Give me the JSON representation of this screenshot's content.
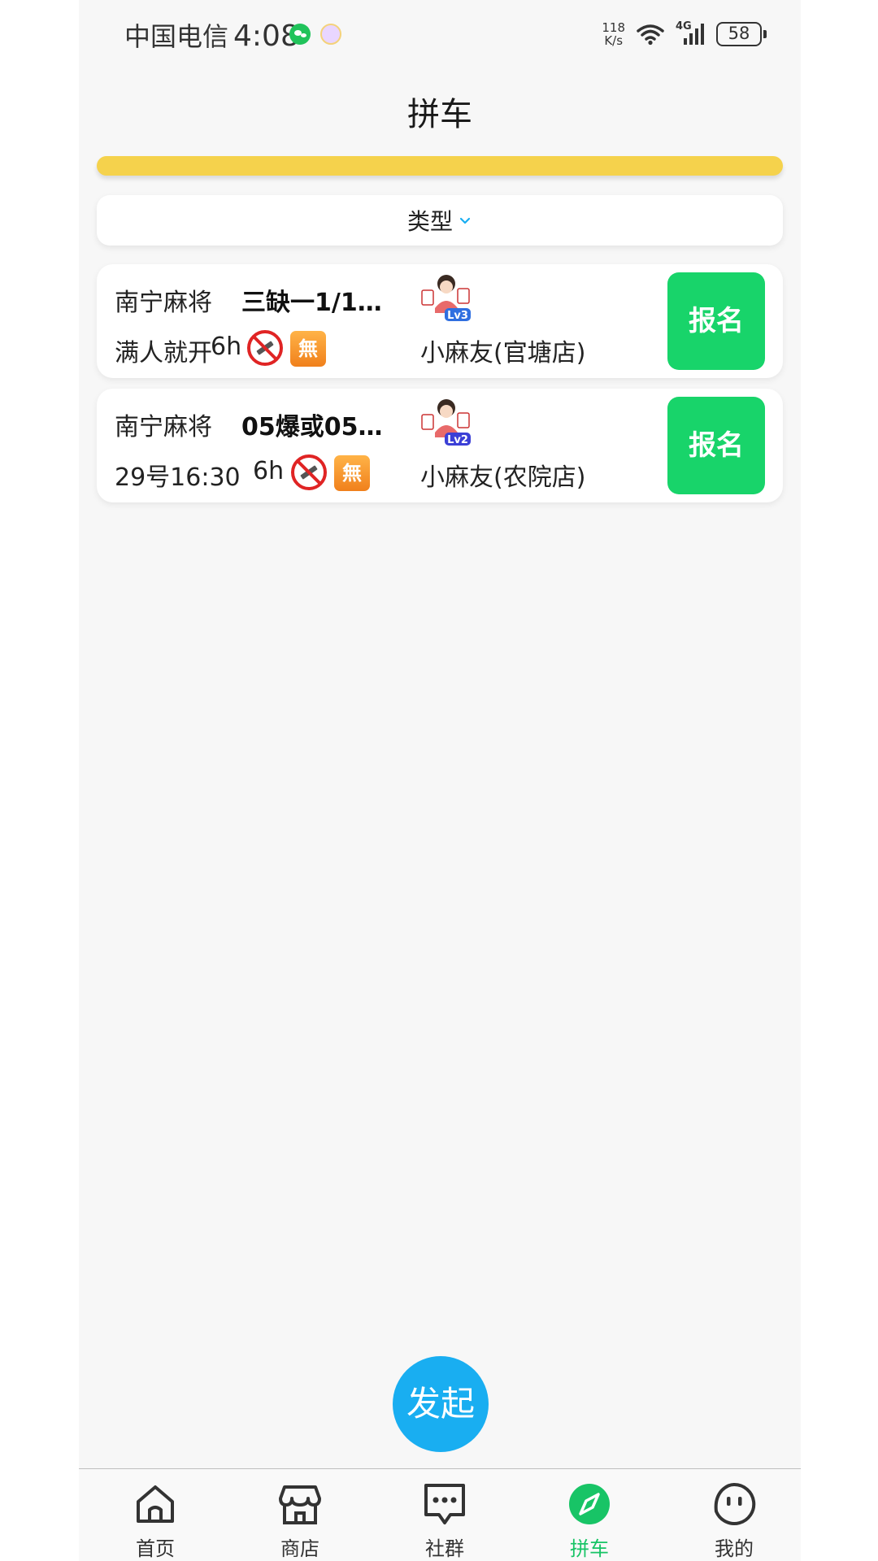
{
  "status_bar": {
    "carrier": "中国电信",
    "time": "4:08",
    "net_speed_value": "118",
    "net_speed_unit": "K/s",
    "network_type": "4G",
    "battery": "58"
  },
  "header": {
    "title": "拼车"
  },
  "filter": {
    "label": "类型"
  },
  "rooms": [
    {
      "game_type": "南宁麻将",
      "rule": "三缺一1/1…",
      "start_condition": "满人就开",
      "duration": "6h",
      "no_smoking_icon": "no-smoking-icon",
      "badge": "無",
      "host_level": "Lv3",
      "shop": "小麻友(官塘店)",
      "action_label": "报名"
    },
    {
      "game_type": "南宁麻将",
      "rule": "05爆或05…",
      "start_condition": "29号16:30",
      "duration": "6h",
      "no_smoking_icon": "no-smoking-icon",
      "badge": "無",
      "host_level": "Lv2",
      "shop": "小麻友(农院店)",
      "action_label": "报名"
    }
  ],
  "launch_button": {
    "label": "发起"
  },
  "tab_bar": {
    "tabs": [
      {
        "label": "首页",
        "icon": "home-icon"
      },
      {
        "label": "商店",
        "icon": "shop-icon"
      },
      {
        "label": "社群",
        "icon": "chat-icon"
      },
      {
        "label": "拼车",
        "icon": "compass-icon",
        "active": true
      },
      {
        "label": "我的",
        "icon": "face-icon"
      }
    ]
  },
  "colors": {
    "accent_yellow": "#f5d24c",
    "signup_green": "#18d46a",
    "launch_blue": "#19aef1",
    "active_tab_green": "#18c466"
  }
}
